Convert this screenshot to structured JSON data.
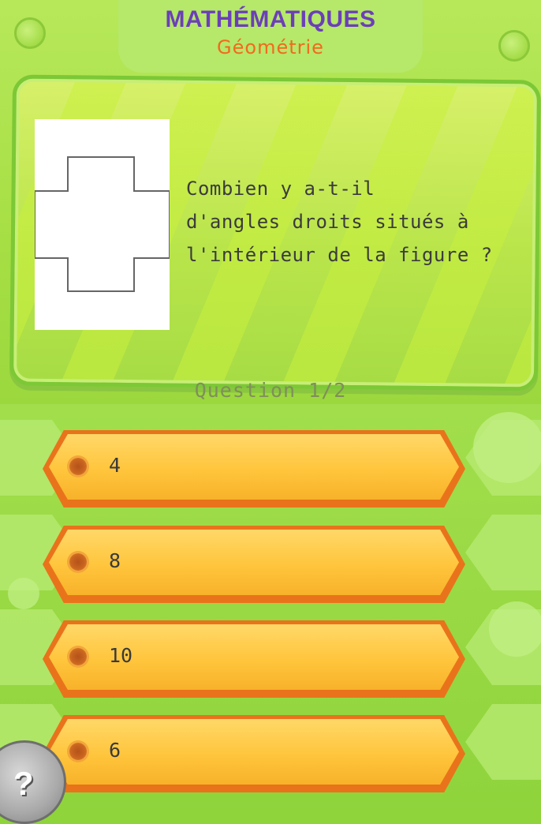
{
  "header": {
    "subject": "MATHÉMATIQUES",
    "topic": "Géométrie"
  },
  "question": {
    "text_lines": [
      "Combien y a-t-il",
      "d'angles droits situés à",
      "l'intérieur de la figure ?"
    ],
    "counter": "Question 1/2",
    "figure": "cross-shape"
  },
  "answers": [
    {
      "label": "4"
    },
    {
      "label": "8"
    },
    {
      "label": "10"
    },
    {
      "label": "6"
    }
  ],
  "help": {
    "icon": "question-mark-icon",
    "label": "?"
  },
  "colors": {
    "subject": "#6b3fb8",
    "topic": "#f26a1d",
    "answer_face": "#ffc53c",
    "answer_border": "#e9731b",
    "background": "#a6df44"
  }
}
